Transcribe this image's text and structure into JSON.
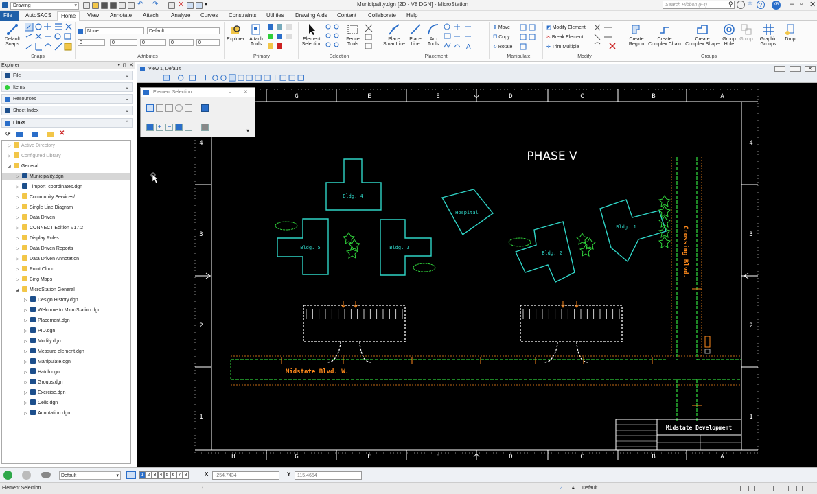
{
  "titlebar": {
    "workflow": "Drawing",
    "title": "Municipality.dgn [2D - V8 DGN] - MicroStation",
    "search_placeholder": "Search Ribbon (F4)",
    "user_initials": "KB"
  },
  "tabs": [
    {
      "label": "File"
    },
    {
      "label": "AutoSACS"
    },
    {
      "label": "Home"
    },
    {
      "label": "View"
    },
    {
      "label": "Annotate"
    },
    {
      "label": "Attach"
    },
    {
      "label": "Analyze"
    },
    {
      "label": "Curves"
    },
    {
      "label": "Constraints"
    },
    {
      "label": "Utilities"
    },
    {
      "label": "Drawing Aids"
    },
    {
      "label": "Content"
    },
    {
      "label": "Collaborate"
    },
    {
      "label": "Help"
    }
  ],
  "ribbon": {
    "snaps": {
      "default_snaps": "Default",
      "default_snaps2": "Snaps",
      "label": "Snaps"
    },
    "attributes": {
      "level": "Default",
      "color": "None",
      "weight": "0",
      "style": "0",
      "line": "0",
      "transp": "0",
      "priority": "0",
      "fill": "0",
      "label": "Attributes"
    },
    "primary": {
      "explorer": "Explorer",
      "attach_tools": "Attach",
      "attach_tools2": "Tools",
      "label": "Primary"
    },
    "selection": {
      "element_selection": "Element",
      "element_selection2": "Selection",
      "fence_tools": "Fence",
      "fence_tools2": "Tools",
      "label": "Selection"
    },
    "placement": {
      "smartline": "Place",
      "smartline2": "SmartLine",
      "line": "Place",
      "line2": "Line",
      "arc": "Arc",
      "arc2": "Tools",
      "label": "Placement"
    },
    "manipulate": {
      "move": "Move",
      "copy": "Copy",
      "rotate": "Rotate",
      "label": "Manipulate"
    },
    "modify": {
      "modify_element": "Modify Element",
      "break_element": "Break Element",
      "trim_multiple": "Trim Multiple",
      "label": "Modify"
    },
    "groups": {
      "create_region": "Create",
      "create_region2": "Region",
      "complex_chain": "Create",
      "complex_chain2": "Complex Chain",
      "complex_shape": "Create",
      "complex_shape2": "Complex Shape",
      "group_hole": "Group",
      "group_hole2": "Hole",
      "group": "Group",
      "graphic_groups": "Graphic",
      "graphic_groups2": "Groups",
      "drop": "Drop",
      "label": "Groups"
    }
  },
  "explorer": {
    "title": "Explorer",
    "sections": [
      {
        "label": "File"
      },
      {
        "label": "Items"
      },
      {
        "label": "Resources"
      },
      {
        "label": "Sheet Index"
      },
      {
        "label": "Links"
      }
    ],
    "tree": [
      {
        "label": "Active Directory",
        "level": 0,
        "type": "folder",
        "dim": true
      },
      {
        "label": "Configured Library",
        "level": 0,
        "type": "folder",
        "dim": true
      },
      {
        "label": "General",
        "level": 0,
        "type": "folder",
        "open": true
      },
      {
        "label": "Municipality.dgn",
        "level": 1,
        "type": "dgn",
        "selected": true
      },
      {
        "label": "_import_coordinates.dgn",
        "level": 1,
        "type": "dgn"
      },
      {
        "label": "Community Services/",
        "level": 1,
        "type": "folder"
      },
      {
        "label": "Single Line Diagram",
        "level": 1,
        "type": "folder"
      },
      {
        "label": "Data Driven",
        "level": 1,
        "type": "folder"
      },
      {
        "label": "CONNECT Edition V17.2",
        "level": 1,
        "type": "folder"
      },
      {
        "label": "Display Rules",
        "level": 1,
        "type": "folder"
      },
      {
        "label": "Data Driven Reports",
        "level": 1,
        "type": "folder"
      },
      {
        "label": "Data Driven Annotation",
        "level": 1,
        "type": "folder"
      },
      {
        "label": "Point Cloud",
        "level": 1,
        "type": "folder"
      },
      {
        "label": "Bing Maps",
        "level": 1,
        "type": "folder"
      },
      {
        "label": "MicroStation General",
        "level": 1,
        "type": "folder",
        "open": true
      },
      {
        "label": "Design History.dgn",
        "level": 2,
        "type": "dgn"
      },
      {
        "label": "Welcome to MicroStation.dgn",
        "level": 2,
        "type": "dgn"
      },
      {
        "label": "Placement.dgn",
        "level": 2,
        "type": "dgn"
      },
      {
        "label": "PID.dgn",
        "level": 2,
        "type": "dgn"
      },
      {
        "label": "Modify.dgn",
        "level": 2,
        "type": "dgn"
      },
      {
        "label": "Measure element.dgn",
        "level": 2,
        "type": "dgn"
      },
      {
        "label": "Manipulate.dgn",
        "level": 2,
        "type": "dgn"
      },
      {
        "label": "Hatch.dgn",
        "level": 2,
        "type": "dgn"
      },
      {
        "label": "Groups.dgn",
        "level": 2,
        "type": "dgn"
      },
      {
        "label": "Exercise.dgn",
        "level": 2,
        "type": "dgn"
      },
      {
        "label": "Cells.dgn",
        "level": 2,
        "type": "dgn"
      },
      {
        "label": "Annotation.dgn",
        "level": 2,
        "type": "dgn"
      }
    ]
  },
  "view": {
    "title": "View 1, Default"
  },
  "element_selection": {
    "title": "Element Selection"
  },
  "drawing": {
    "title": "PHASE V",
    "cols": [
      "H",
      "G",
      "E",
      "E",
      "D",
      "C",
      "B",
      "A"
    ],
    "cols_top": [
      "G",
      "E",
      "E",
      "D",
      "C",
      "B",
      "A"
    ],
    "rows": [
      "4",
      "3",
      "2",
      "1"
    ],
    "buildings": {
      "b4": "Bldg. 4",
      "b5": "Bldg. 5",
      "b3": "Bldg. 3",
      "hosp": "Hospital",
      "b2": "Bldg. 2",
      "b1": "Bldg. 1"
    },
    "street_h": "Midstate Blvd. W.",
    "street_v": "Crossing Blvd.",
    "title_block": "Midstate Development"
  },
  "status": {
    "level": "Default",
    "view_numbers": [
      "1",
      "2",
      "3",
      "4",
      "5",
      "6",
      "7",
      "8"
    ],
    "x_label": "X",
    "x_value": "-254.7434",
    "y_label": "Y",
    "y_value": "115.4654",
    "prompt": "Element Selection",
    "active_level": "Default"
  },
  "colors": {
    "cyan": "#2fd4c6",
    "orange": "#ff8a1c",
    "green": "#2fcf3a",
    "white": "#ffffff"
  }
}
